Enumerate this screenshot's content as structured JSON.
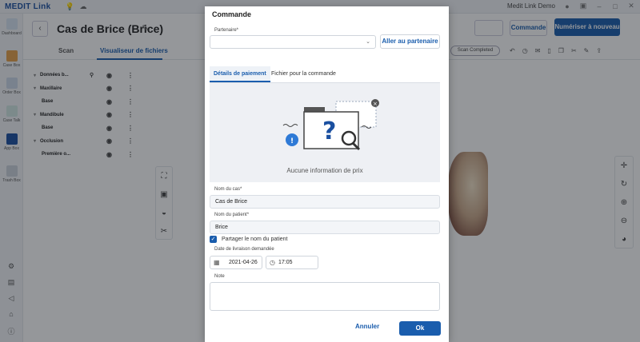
{
  "app": {
    "brand": "MEDIT Link",
    "user": "Medit Link Demo"
  },
  "sidebar": {
    "items": [
      {
        "label": "Dashboard"
      },
      {
        "label": "Case Box"
      },
      {
        "label": "Order Box"
      },
      {
        "label": "Case Talk"
      },
      {
        "label": "App Box"
      },
      {
        "label": "Trash Box"
      }
    ]
  },
  "header": {
    "back": "‹",
    "case_title": "Cas de Brice (Brice)",
    "edit": "✎"
  },
  "tabs": [
    {
      "label": "Scan"
    },
    {
      "label": "Visualiseur de fichiers"
    }
  ],
  "tree": [
    {
      "label": "Données b...",
      "caret": "▾",
      "has_pin": true
    },
    {
      "label": "Maxillaire",
      "caret": "▾"
    },
    {
      "label": "Base",
      "caret": ""
    },
    {
      "label": "Mandibule",
      "caret": "▾"
    },
    {
      "label": "Base",
      "caret": ""
    },
    {
      "label": "Occlusion",
      "caret": "▾"
    },
    {
      "label": "Première o...",
      "caret": ""
    }
  ],
  "actions": {
    "commande": "Commande",
    "scan": "Numériser à nouveau",
    "status": "Scan Completed"
  },
  "modal": {
    "title": "Commande",
    "partner_label": "Partenaire*",
    "partner_value": "",
    "goto_partner": "Aller au partenaire",
    "tabs": [
      {
        "label": "Détails de paiement"
      },
      {
        "label": "Fichier pour la commande"
      }
    ],
    "empty_text": "Aucune information de prix",
    "case_name_label": "Nom du cas*",
    "case_name": "Cas de Brice",
    "patient_label": "Nom du patient*",
    "patient_name": "Brice",
    "share_label": "Partager le nom du patient",
    "share_checked": true,
    "date_label": "Date de livraison demandée",
    "date": "2021-04-26",
    "time": "17:05",
    "note_label": "Note",
    "note": "",
    "cancel": "Annuler",
    "ok": "Ok"
  },
  "colors": {
    "accent": "#1a5dad",
    "overlay": "rgba(20,24,30,0.45)"
  }
}
